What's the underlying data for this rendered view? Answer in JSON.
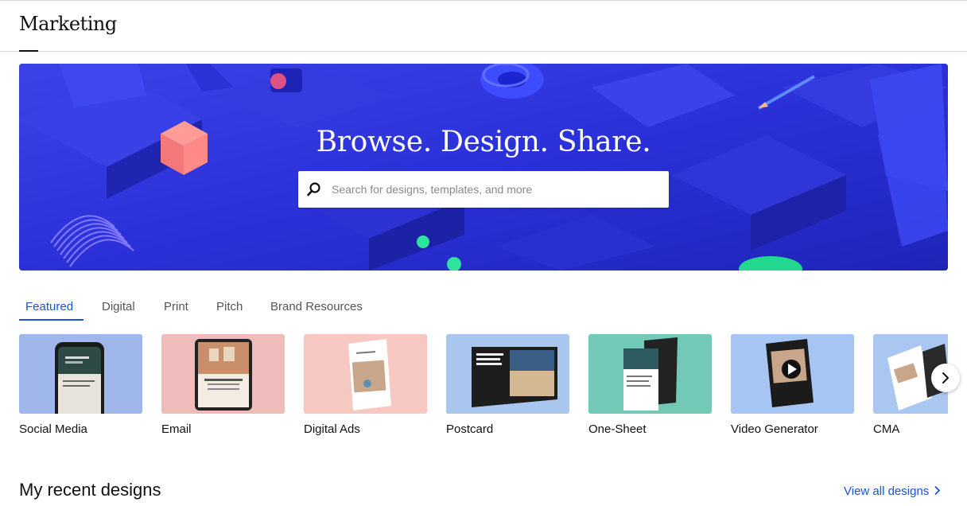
{
  "header": {
    "title": "Marketing"
  },
  "hero": {
    "heading": "Browse. Design. Share.",
    "search_placeholder": "Search for designs, templates, and more",
    "search_value": ""
  },
  "tabs": [
    {
      "label": "Featured",
      "active": true
    },
    {
      "label": "Digital",
      "active": false
    },
    {
      "label": "Print",
      "active": false
    },
    {
      "label": "Pitch",
      "active": false
    },
    {
      "label": "Brand Resources",
      "active": false
    }
  ],
  "categories": [
    {
      "label": "Social Media"
    },
    {
      "label": "Email"
    },
    {
      "label": "Digital Ads"
    },
    {
      "label": "Postcard"
    },
    {
      "label": "One-Sheet"
    },
    {
      "label": "Video Generator"
    },
    {
      "label": "CMA"
    }
  ],
  "recent": {
    "heading": "My recent designs",
    "view_all_label": "View all designs"
  },
  "icons": {
    "search": "search-icon",
    "next": "chevron-right-icon"
  },
  "colors": {
    "accent": "#1a54d1",
    "hero_bg": "#2a2fd6"
  }
}
